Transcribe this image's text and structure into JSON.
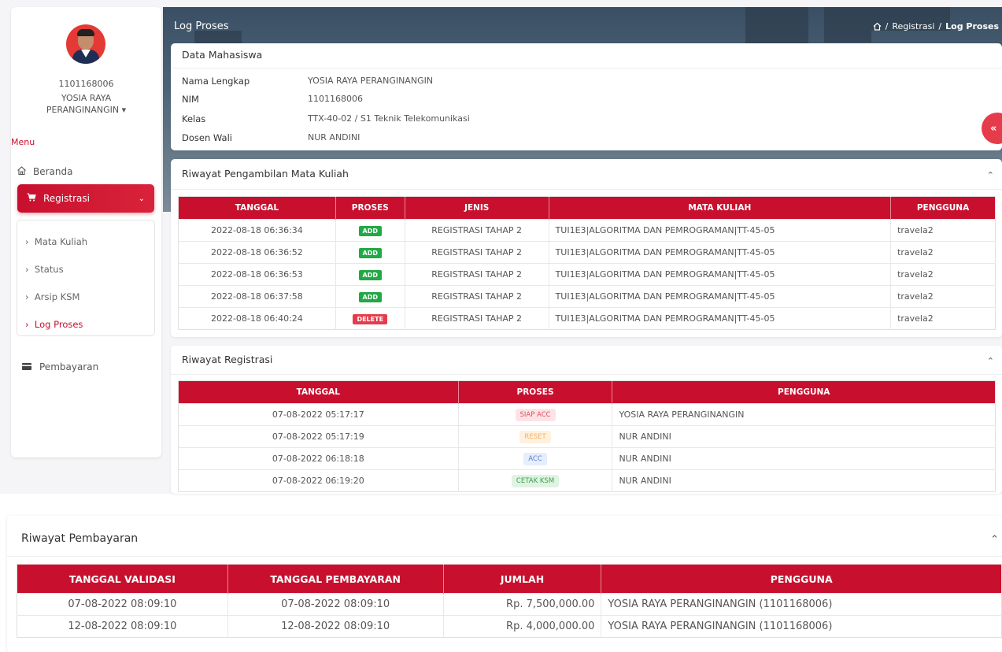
{
  "header": {
    "page_title": "Log Proses",
    "breadcrumb": [
      "Registrasi",
      "Log Proses"
    ]
  },
  "sidebar": {
    "user_id": "1101168006",
    "user_name": "YOSIA RAYA PERANGINANGIN",
    "menu_label": "Menu",
    "items": {
      "beranda": "Beranda",
      "registrasi": "Registrasi",
      "pembayaran": "Pembayaran"
    },
    "submenu": [
      "Mata Kuliah",
      "Status",
      "Arsip KSM",
      "Log Proses"
    ],
    "active_submenu": "Log Proses"
  },
  "mahasiswa": {
    "title": "Data Mahasiswa",
    "fields": [
      {
        "label": "Nama Lengkap",
        "value": "YOSIA RAYA PERANGINANGIN"
      },
      {
        "label": "NIM",
        "value": "1101168006"
      },
      {
        "label": "Kelas",
        "value": "TTX-40-02 / S1 Teknik Telekomunikasi"
      },
      {
        "label": "Dosen Wali",
        "value": "NUR ANDINI"
      }
    ]
  },
  "mata_kuliah": {
    "title": "Riwayat Pengambilan Mata Kuliah",
    "columns": [
      "TANGGAL",
      "PROSES",
      "JENIS",
      "MATA KULIAH",
      "PENGGUNA"
    ],
    "rows": [
      {
        "tanggal": "2022-08-18 06:36:34",
        "proses": "ADD",
        "jenis": "REGISTRASI TAHAP 2",
        "mk": "TUI1E3|ALGORITMA DAN PEMROGRAMAN|TT-45-05",
        "pengguna": "travela2"
      },
      {
        "tanggal": "2022-08-18 06:36:52",
        "proses": "ADD",
        "jenis": "REGISTRASI TAHAP 2",
        "mk": "TUI1E3|ALGORITMA DAN PEMROGRAMAN|TT-45-05",
        "pengguna": "travela2"
      },
      {
        "tanggal": "2022-08-18 06:36:53",
        "proses": "ADD",
        "jenis": "REGISTRASI TAHAP 2",
        "mk": "TUI1E3|ALGORITMA DAN PEMROGRAMAN|TT-45-05",
        "pengguna": "travela2"
      },
      {
        "tanggal": "2022-08-18 06:37:58",
        "proses": "ADD",
        "jenis": "REGISTRASI TAHAP 2",
        "mk": "TUI1E3|ALGORITMA DAN PEMROGRAMAN|TT-45-05",
        "pengguna": "travela2"
      },
      {
        "tanggal": "2022-08-18 06:40:24",
        "proses": "DELETE",
        "jenis": "REGISTRASI TAHAP 2",
        "mk": "TUI1E3|ALGORITMA DAN PEMROGRAMAN|TT-45-05",
        "pengguna": "travela2"
      }
    ]
  },
  "registrasi": {
    "title": "Riwayat Registrasi",
    "columns": [
      "TANGGAL",
      "PROSES",
      "PENGGUNA"
    ],
    "rows": [
      {
        "tanggal": "07-08-2022 05:17:17",
        "proses": "SIAP ACC",
        "pengguna": "YOSIA RAYA PERANGINANGIN"
      },
      {
        "tanggal": "07-08-2022 05:17:19",
        "proses": "RESET",
        "pengguna": "NUR ANDINI"
      },
      {
        "tanggal": "07-08-2022 06:18:18",
        "proses": "ACC",
        "pengguna": "NUR ANDINI"
      },
      {
        "tanggal": "07-08-2022 06:19:20",
        "proses": "CETAK KSM",
        "pengguna": "NUR ANDINI"
      }
    ]
  },
  "pembayaran": {
    "title": "Riwayat Pembayaran",
    "columns": [
      "TANGGAL VALIDASI",
      "TANGGAL PEMBAYARAN",
      "JUMLAH",
      "PENGGUNA"
    ],
    "rows": [
      {
        "validasi": "07-08-2022 08:09:10",
        "pembayaran": "07-08-2022 08:09:10",
        "jumlah": "Rp. 7,500,000.00",
        "pengguna": "YOSIA RAYA PERANGINANGIN (1101168006)"
      },
      {
        "validasi": "12-08-2022 08:09:10",
        "pembayaran": "12-08-2022 08:09:10",
        "jumlah": "Rp. 4,000,000.00",
        "pengguna": "YOSIA RAYA PERANGINANGIN (1101168006)"
      }
    ]
  },
  "colors": {
    "primary": "#c8102e",
    "add": "#22a845",
    "delete": "#e53c4c"
  }
}
